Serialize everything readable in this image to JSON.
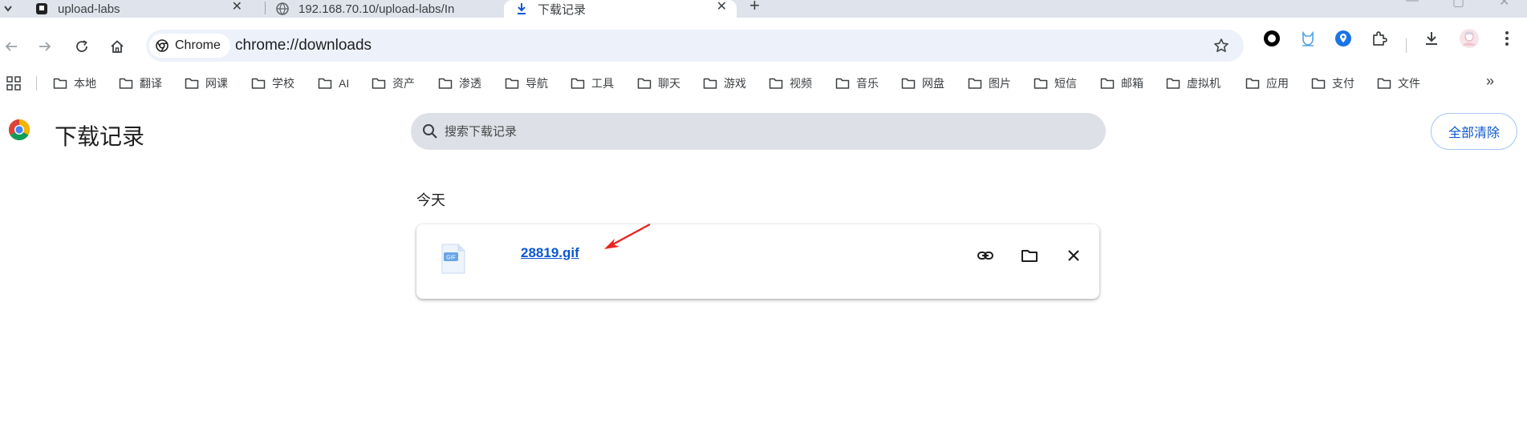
{
  "tabs": [
    {
      "title": "upload-labs",
      "favicon": "upload-labs-icon",
      "active": false
    },
    {
      "title": "192.168.70.10/upload-labs/In",
      "favicon": "globe-icon",
      "active": false
    },
    {
      "title": "下载记录",
      "favicon": "download-icon",
      "active": true
    }
  ],
  "toolbar": {
    "chip_label": "Chrome",
    "url": "chrome://downloads"
  },
  "bookmarks": [
    "本地",
    "翻译",
    "网课",
    "学校",
    "AI",
    "资产",
    "渗透",
    "导航",
    "工具",
    "聊天",
    "游戏",
    "视频",
    "音乐",
    "网盘",
    "图片",
    "短信",
    "邮箱",
    "虚拟机",
    "应用",
    "支付",
    "文件"
  ],
  "page": {
    "title": "下载记录",
    "search_placeholder": "搜索下载记录",
    "clear_all_label": "全部清除",
    "date_group": "今天"
  },
  "downloads": [
    {
      "filename": "28819.gif",
      "type_label": "GIF"
    }
  ],
  "colors": {
    "accent": "#0b57d0",
    "tabstrip_bg": "#dfe3eb",
    "omnibox_bg": "#edf2fa",
    "search_bg": "#dde1e7",
    "annotation_arrow": "#e8251f"
  }
}
